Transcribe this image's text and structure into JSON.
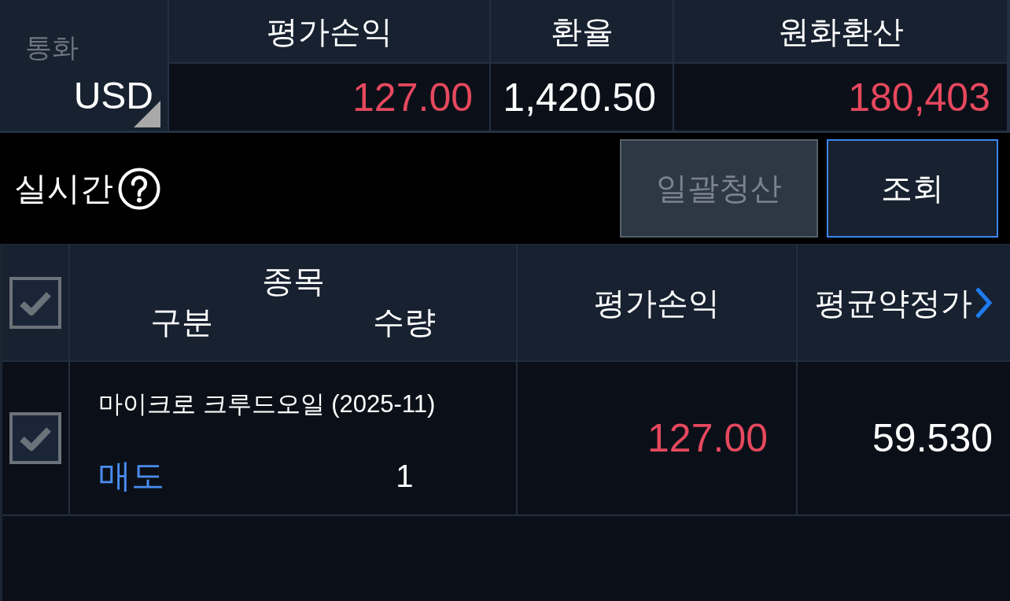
{
  "summary": {
    "currency": {
      "label": "통화",
      "value": "USD"
    },
    "columns": [
      {
        "header": "평가손익",
        "value": "127.00",
        "color": "#e6485e"
      },
      {
        "header": "환율",
        "value": "1,420.50",
        "color": "#ffffff"
      },
      {
        "header": "원화환산",
        "value": "180,403",
        "color": "#e6485e"
      }
    ]
  },
  "toolbar": {
    "label": "실시간",
    "buttons": [
      {
        "label": "일괄청산",
        "disabled": true
      },
      {
        "label": "조회",
        "disabled": false
      }
    ]
  },
  "table": {
    "select_all": {
      "checked": true
    },
    "columns": [
      {
        "kind": "stacked",
        "top": "종목",
        "left": "구분",
        "right": "수량"
      },
      {
        "kind": "plain",
        "label": "평가손익",
        "more": false
      },
      {
        "kind": "plain",
        "label": "평균약정가",
        "more": true
      }
    ],
    "rows": [
      {
        "checked": true,
        "name": "마이크로 크루드오일 (2025-11)",
        "side": {
          "text": "매도",
          "color": "#4a8cf0"
        },
        "quantity": "1",
        "profit": {
          "text": "127.00",
          "color": "#e6485e"
        },
        "avg_price": "59.530"
      }
    ]
  }
}
